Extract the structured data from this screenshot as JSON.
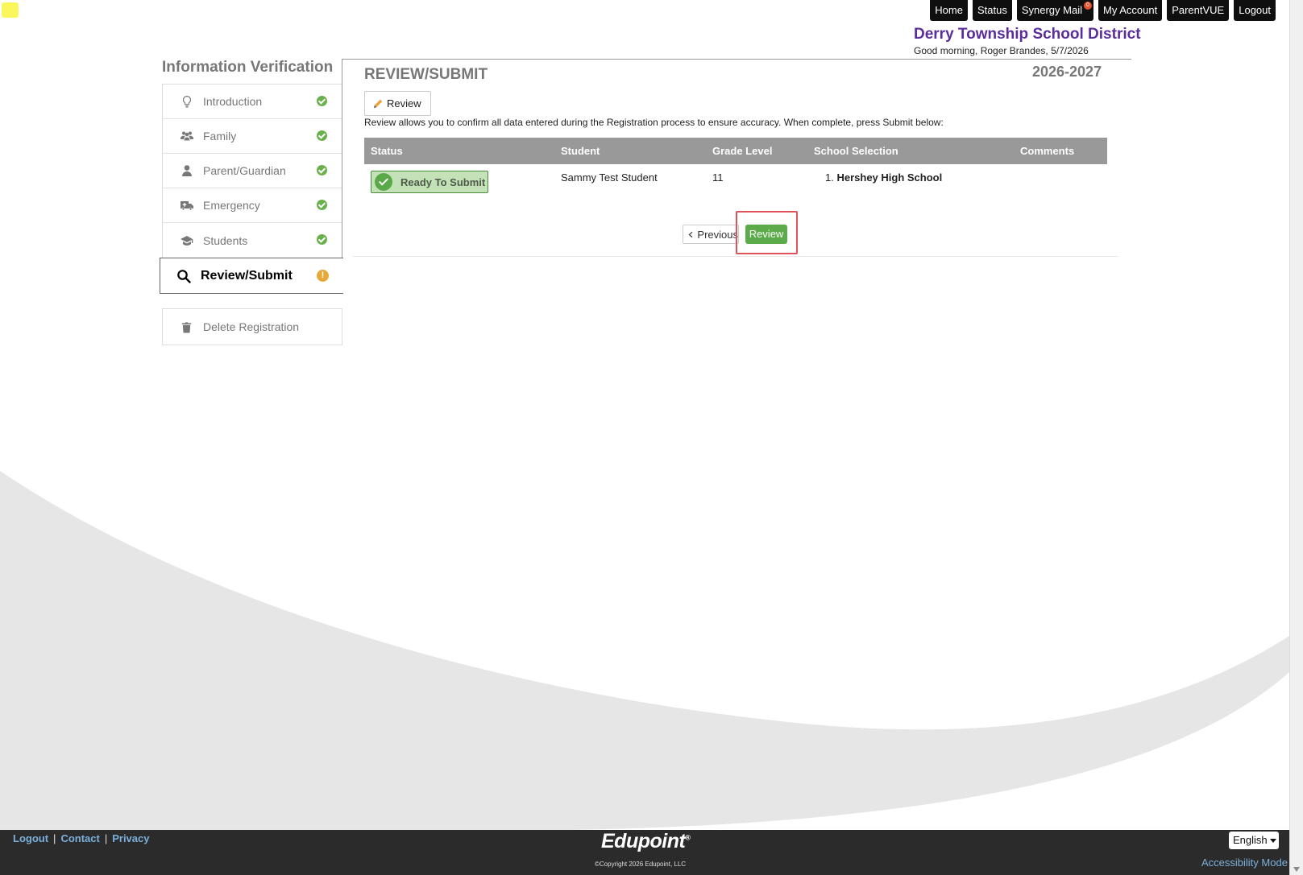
{
  "topnav": {
    "home": "Home",
    "status": "Status",
    "mail": "Synergy Mail",
    "mail_badge": "0",
    "account": "My Account",
    "parentvue": "ParentVUE",
    "logout": "Logout"
  },
  "header": {
    "district": "Derry Township School District",
    "greeting": "Good morning, Roger Brandes, 5/7/2026"
  },
  "sidebar": {
    "title": "Information Verification",
    "items": [
      {
        "label": "Introduction",
        "icon": "lightbulb-icon",
        "status": "complete"
      },
      {
        "label": "Family",
        "icon": "users-icon",
        "status": "complete"
      },
      {
        "label": "Parent/Guardian",
        "icon": "user-icon",
        "status": "complete"
      },
      {
        "label": "Emergency",
        "icon": "ambulance-icon",
        "status": "complete"
      },
      {
        "label": "Students",
        "icon": "graduation-cap-icon",
        "status": "complete"
      }
    ],
    "active": {
      "label": "Review/Submit",
      "icon": "search-icon",
      "status": "warning",
      "status_glyph": "!"
    },
    "delete": "Delete Registration"
  },
  "main": {
    "title": "REVIEW/SUBMIT",
    "school_year": "2026-2027",
    "review_tab": "Review",
    "intro": "Review allows you to confirm all data entered during the Registration process to ensure accuracy. When complete, press Submit below:",
    "table": {
      "headers": [
        "Status",
        "Student",
        "Grade Level",
        "School Selection",
        "Comments"
      ],
      "rows": [
        {
          "status": "Ready To Submit",
          "student": "Sammy Test Student",
          "grade": "11",
          "school_num": "1.",
          "school": "Hershey High School",
          "comments": ""
        }
      ]
    },
    "prev_label": "Previous",
    "next_label": "Review"
  },
  "footer": {
    "logout": "Logout",
    "contact": "Contact",
    "privacy": "Privacy",
    "logo": "Edupoint",
    "copyright": "©Copyright 2026 Edupoint, LLC",
    "language": "English",
    "accessibility": "Accessibility Mode"
  },
  "colors": {
    "district": "#5a2d9c",
    "complete": "#6ab04c",
    "warning": "#e8a93a",
    "primary_button": "#5cab4b",
    "highlight": "#e05259",
    "footer_bg": "#2b2b2b",
    "link": "#7cb0dc"
  }
}
